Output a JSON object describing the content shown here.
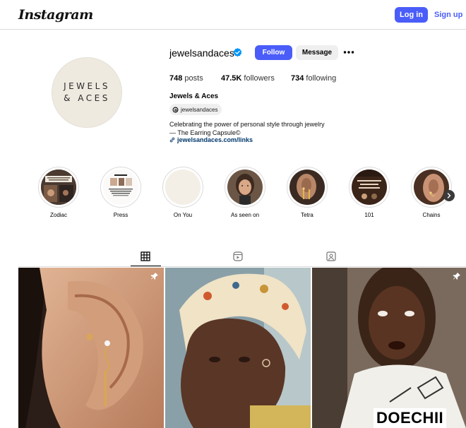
{
  "topbar": {
    "logo": "Instagram",
    "login_label": "Log in",
    "signup_label": "Sign up"
  },
  "profile": {
    "avatar_line1": "JEWELS",
    "avatar_line2": "& ACES",
    "username": "jewelsandaces",
    "follow_label": "Follow",
    "message_label": "Message",
    "stats": {
      "posts_count": "748",
      "posts_label": "posts",
      "followers_count": "47.5K",
      "followers_label": "followers",
      "following_count": "734",
      "following_label": "following"
    },
    "full_name": "Jewels & Aces",
    "threads_handle": "jewelsandaces",
    "bio_line1": "Celebrating the power of personal style through jewelry",
    "bio_line2": "— The Earring Capsule©",
    "link": "jewelsandaces.com/links"
  },
  "highlights": [
    {
      "label": "Zodiac",
      "icon": "zodiac-cover"
    },
    {
      "label": "Press",
      "icon": "press-cover"
    },
    {
      "label": "On You",
      "icon": "on-you-cover"
    },
    {
      "label": "As seen on",
      "icon": "as-seen-on-cover"
    },
    {
      "label": "Tetra",
      "icon": "tetra-cover"
    },
    {
      "label": "101",
      "icon": "101-cover"
    },
    {
      "label": "Chains",
      "icon": "chains-cover"
    }
  ],
  "tabs": [
    {
      "name": "posts",
      "icon": "grid-icon",
      "active": true
    },
    {
      "name": "reels",
      "icon": "reels-icon",
      "active": false
    },
    {
      "name": "tagged",
      "icon": "tagged-icon",
      "active": false
    }
  ],
  "posts": [
    {
      "name": "ear-earrings-photo",
      "pinned": true,
      "overlay_text": ""
    },
    {
      "name": "headscarf-portrait-photo",
      "pinned": false,
      "overlay_text": ""
    },
    {
      "name": "doechii-photo",
      "pinned": true,
      "overlay_text": "DOECHII"
    }
  ],
  "colors": {
    "accent": "#4a5df9",
    "link": "#00376b",
    "border": "#dbdbdb",
    "avatar_bg": "#efeae0"
  }
}
